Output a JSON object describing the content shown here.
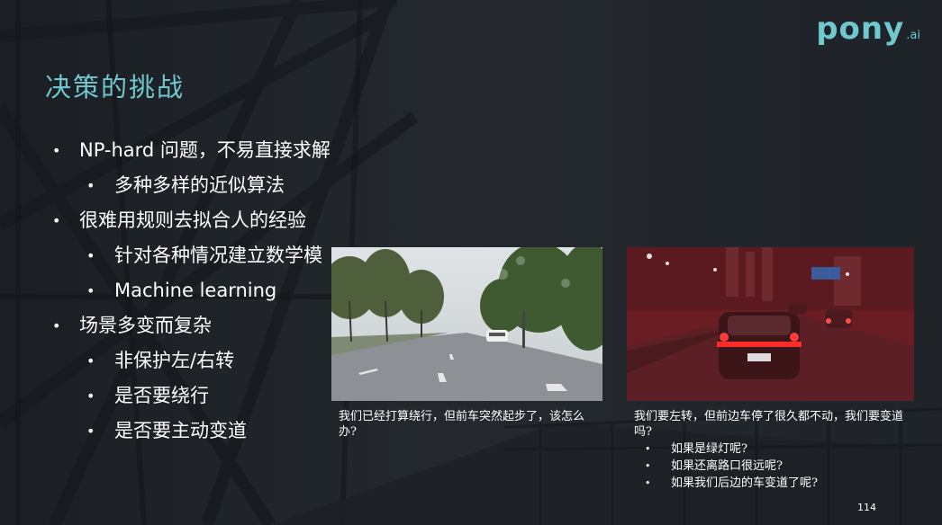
{
  "slide": {
    "title": "决策的挑战",
    "logo": {
      "main": "pony",
      "sub": ".ai"
    },
    "bullets": [
      {
        "level": 1,
        "text": "NP-hard 问题，不易直接求解"
      },
      {
        "level": 2,
        "text": "多种多样的近似算法"
      },
      {
        "level": 1,
        "text": "很难用规则去拟合人的经验"
      },
      {
        "level": 2,
        "text": "针对各种情况建立数学模"
      },
      {
        "level": 2,
        "text": "Machine learning"
      },
      {
        "level": 1,
        "text": "场景多变而复杂"
      },
      {
        "level": 2,
        "text": "非保护左/右转"
      },
      {
        "level": 2,
        "text": "是否要绕行"
      },
      {
        "level": 2,
        "text": "是否要主动变道"
      }
    ],
    "bullet_symbol": "•",
    "photo1_caption": "我们已经打算绕行，但前车突然起步了，该怎么办?",
    "photo2_caption": "我们要左转，但前边车停了很久都不动，我们要变道吗?",
    "photo2_questions": [
      "如果是绿灯呢?",
      "如果还离路口很远呢?",
      "如果我们后边的车变道了呢?"
    ],
    "page_number": "114",
    "colors": {
      "accent": "#6ec8cd",
      "text": "#ffffff",
      "background": "#262b31"
    }
  }
}
